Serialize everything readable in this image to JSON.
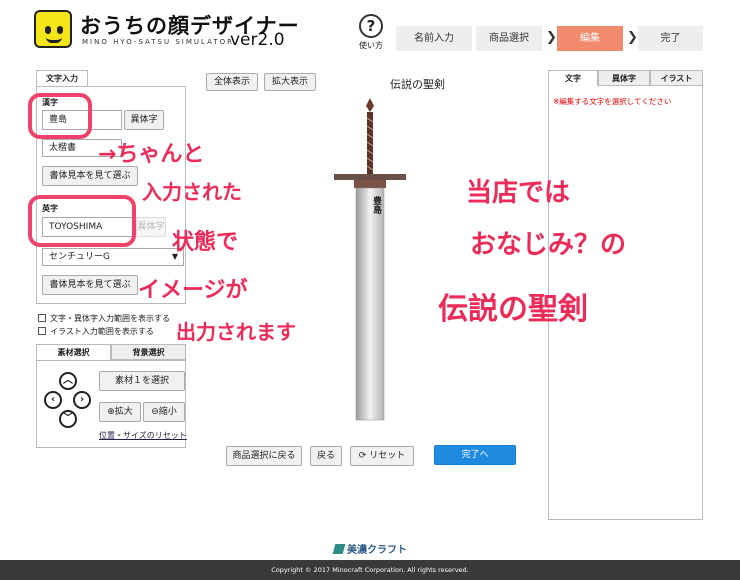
{
  "header": {
    "logo_title": "おうちの顔デザイナー",
    "logo_sub": "MINO HYO-SATSU SIMULATOR",
    "logo_ver": "ver2.0",
    "howto_label": "使い方",
    "steps": [
      "名前入力",
      "商品選択",
      "編集",
      "完了"
    ],
    "active_step": "編集"
  },
  "left": {
    "tab_label": "文字入力",
    "kanji_label": "漢字",
    "kanji_value": "豊島",
    "variant_button": "異体字",
    "kanji_font": "太楷書",
    "sample_button": "書体見本を見て選ぶ",
    "eiji_label": "英字",
    "eiji_value": "TOYOSHIMA",
    "eiji_variant_button": "異体字",
    "eiji_font": "センチュリーG",
    "eiji_sample_button": "書体見本を見て選ぶ",
    "check1": "文字・異体字入力範囲を表示する",
    "check2": "イラスト入力範囲を表示する",
    "material_tab": "素材選択",
    "bg_tab": "背景選択",
    "select_material": "素材１を選択",
    "zoom_in": "拡大",
    "zoom_out": "縮小",
    "reset_link": "位置・サイズのリセット"
  },
  "center": {
    "show_all": "全体表示",
    "show_zoom": "拡大表示",
    "title": "伝説の聖剣",
    "blade_text": "豊島",
    "back_product": "商品選択に戻る",
    "back": "戻る",
    "reset": "リセット",
    "done": "完了へ"
  },
  "right": {
    "tabs": [
      "文字",
      "異体字",
      "イラスト"
    ],
    "notice": "※編集する文字を選択してください"
  },
  "annotations": {
    "a1": "→ちゃんと",
    "a2": "入力された",
    "a3": "状態で",
    "a4": "イメージが",
    "a5": "出力されます",
    "b1": "当店では",
    "b2": "おなじみ？の",
    "b3": "伝説の聖剣"
  },
  "footer": {
    "brand": "美濃クラフト",
    "copyright": "Copyright © 2017 Minocraft Corporation. All rights reserved."
  },
  "colors": {
    "accent": "#f28b6e",
    "primary_button": "#1e8be0",
    "annotation": "#ee2a58"
  }
}
